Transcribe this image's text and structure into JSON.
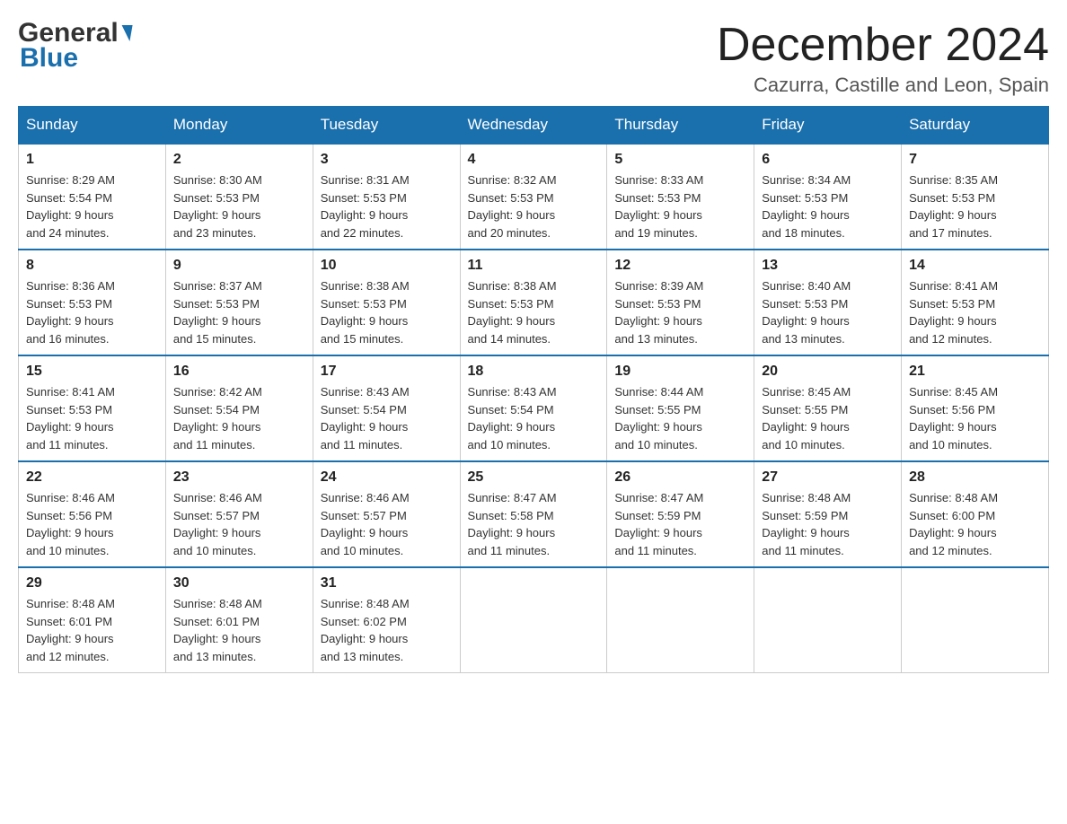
{
  "header": {
    "logo_line1": "General",
    "logo_line2": "Blue",
    "month_title": "December 2024",
    "location": "Cazurra, Castille and Leon, Spain"
  },
  "days_of_week": [
    "Sunday",
    "Monday",
    "Tuesday",
    "Wednesday",
    "Thursday",
    "Friday",
    "Saturday"
  ],
  "weeks": [
    [
      {
        "day": "1",
        "sunrise": "8:29 AM",
        "sunset": "5:54 PM",
        "daylight": "9 hours and 24 minutes."
      },
      {
        "day": "2",
        "sunrise": "8:30 AM",
        "sunset": "5:53 PM",
        "daylight": "9 hours and 23 minutes."
      },
      {
        "day": "3",
        "sunrise": "8:31 AM",
        "sunset": "5:53 PM",
        "daylight": "9 hours and 22 minutes."
      },
      {
        "day": "4",
        "sunrise": "8:32 AM",
        "sunset": "5:53 PM",
        "daylight": "9 hours and 20 minutes."
      },
      {
        "day": "5",
        "sunrise": "8:33 AM",
        "sunset": "5:53 PM",
        "daylight": "9 hours and 19 minutes."
      },
      {
        "day": "6",
        "sunrise": "8:34 AM",
        "sunset": "5:53 PM",
        "daylight": "9 hours and 18 minutes."
      },
      {
        "day": "7",
        "sunrise": "8:35 AM",
        "sunset": "5:53 PM",
        "daylight": "9 hours and 17 minutes."
      }
    ],
    [
      {
        "day": "8",
        "sunrise": "8:36 AM",
        "sunset": "5:53 PM",
        "daylight": "9 hours and 16 minutes."
      },
      {
        "day": "9",
        "sunrise": "8:37 AM",
        "sunset": "5:53 PM",
        "daylight": "9 hours and 15 minutes."
      },
      {
        "day": "10",
        "sunrise": "8:38 AM",
        "sunset": "5:53 PM",
        "daylight": "9 hours and 15 minutes."
      },
      {
        "day": "11",
        "sunrise": "8:38 AM",
        "sunset": "5:53 PM",
        "daylight": "9 hours and 14 minutes."
      },
      {
        "day": "12",
        "sunrise": "8:39 AM",
        "sunset": "5:53 PM",
        "daylight": "9 hours and 13 minutes."
      },
      {
        "day": "13",
        "sunrise": "8:40 AM",
        "sunset": "5:53 PM",
        "daylight": "9 hours and 13 minutes."
      },
      {
        "day": "14",
        "sunrise": "8:41 AM",
        "sunset": "5:53 PM",
        "daylight": "9 hours and 12 minutes."
      }
    ],
    [
      {
        "day": "15",
        "sunrise": "8:41 AM",
        "sunset": "5:53 PM",
        "daylight": "9 hours and 11 minutes."
      },
      {
        "day": "16",
        "sunrise": "8:42 AM",
        "sunset": "5:54 PM",
        "daylight": "9 hours and 11 minutes."
      },
      {
        "day": "17",
        "sunrise": "8:43 AM",
        "sunset": "5:54 PM",
        "daylight": "9 hours and 11 minutes."
      },
      {
        "day": "18",
        "sunrise": "8:43 AM",
        "sunset": "5:54 PM",
        "daylight": "9 hours and 10 minutes."
      },
      {
        "day": "19",
        "sunrise": "8:44 AM",
        "sunset": "5:55 PM",
        "daylight": "9 hours and 10 minutes."
      },
      {
        "day": "20",
        "sunrise": "8:45 AM",
        "sunset": "5:55 PM",
        "daylight": "9 hours and 10 minutes."
      },
      {
        "day": "21",
        "sunrise": "8:45 AM",
        "sunset": "5:56 PM",
        "daylight": "9 hours and 10 minutes."
      }
    ],
    [
      {
        "day": "22",
        "sunrise": "8:46 AM",
        "sunset": "5:56 PM",
        "daylight": "9 hours and 10 minutes."
      },
      {
        "day": "23",
        "sunrise": "8:46 AM",
        "sunset": "5:57 PM",
        "daylight": "9 hours and 10 minutes."
      },
      {
        "day": "24",
        "sunrise": "8:46 AM",
        "sunset": "5:57 PM",
        "daylight": "9 hours and 10 minutes."
      },
      {
        "day": "25",
        "sunrise": "8:47 AM",
        "sunset": "5:58 PM",
        "daylight": "9 hours and 11 minutes."
      },
      {
        "day": "26",
        "sunrise": "8:47 AM",
        "sunset": "5:59 PM",
        "daylight": "9 hours and 11 minutes."
      },
      {
        "day": "27",
        "sunrise": "8:48 AM",
        "sunset": "5:59 PM",
        "daylight": "9 hours and 11 minutes."
      },
      {
        "day": "28",
        "sunrise": "8:48 AM",
        "sunset": "6:00 PM",
        "daylight": "9 hours and 12 minutes."
      }
    ],
    [
      {
        "day": "29",
        "sunrise": "8:48 AM",
        "sunset": "6:01 PM",
        "daylight": "9 hours and 12 minutes."
      },
      {
        "day": "30",
        "sunrise": "8:48 AM",
        "sunset": "6:01 PM",
        "daylight": "9 hours and 13 minutes."
      },
      {
        "day": "31",
        "sunrise": "8:48 AM",
        "sunset": "6:02 PM",
        "daylight": "9 hours and 13 minutes."
      },
      null,
      null,
      null,
      null
    ]
  ],
  "labels": {
    "sunrise": "Sunrise:",
    "sunset": "Sunset:",
    "daylight": "Daylight:"
  }
}
